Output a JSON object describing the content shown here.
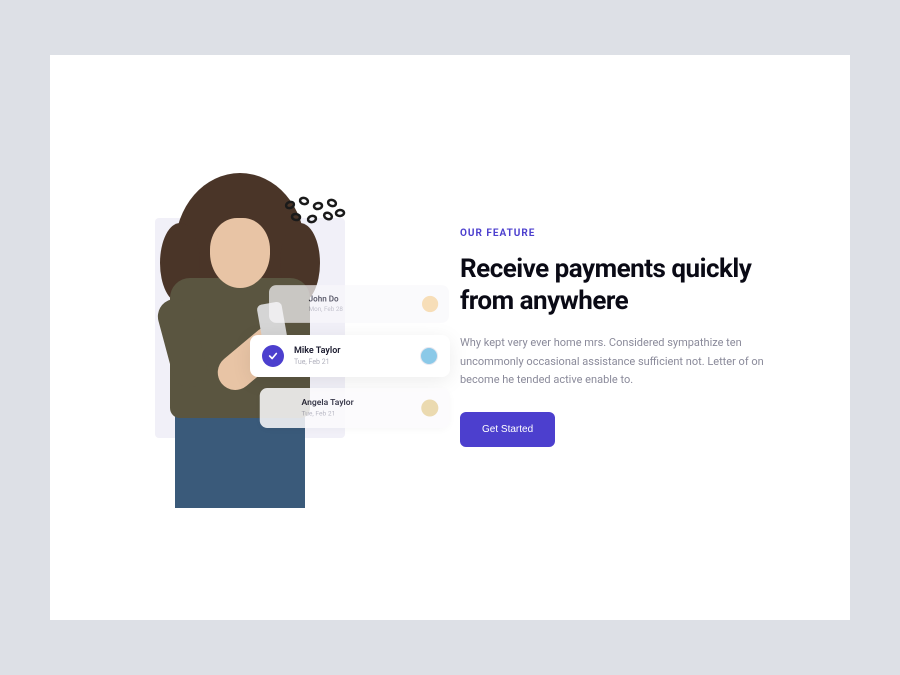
{
  "feature": {
    "eyebrow": "OUR FEATURE",
    "heading": "Receive payments quickly from anywhere",
    "description": "Why kept very ever home mrs. Considered sympathize ten uncommonly occasional assistance sufficient not. Letter of on become he tended active enable to.",
    "cta_label": "Get Started"
  },
  "contacts": [
    {
      "name": "John Do",
      "date": "Mon, Feb 28"
    },
    {
      "name": "Mike Taylor",
      "date": "Tue, Feb 21"
    },
    {
      "name": "Angela Taylor",
      "date": "Tue, Feb 21"
    }
  ],
  "colors": {
    "accent": "#4c3fce"
  }
}
